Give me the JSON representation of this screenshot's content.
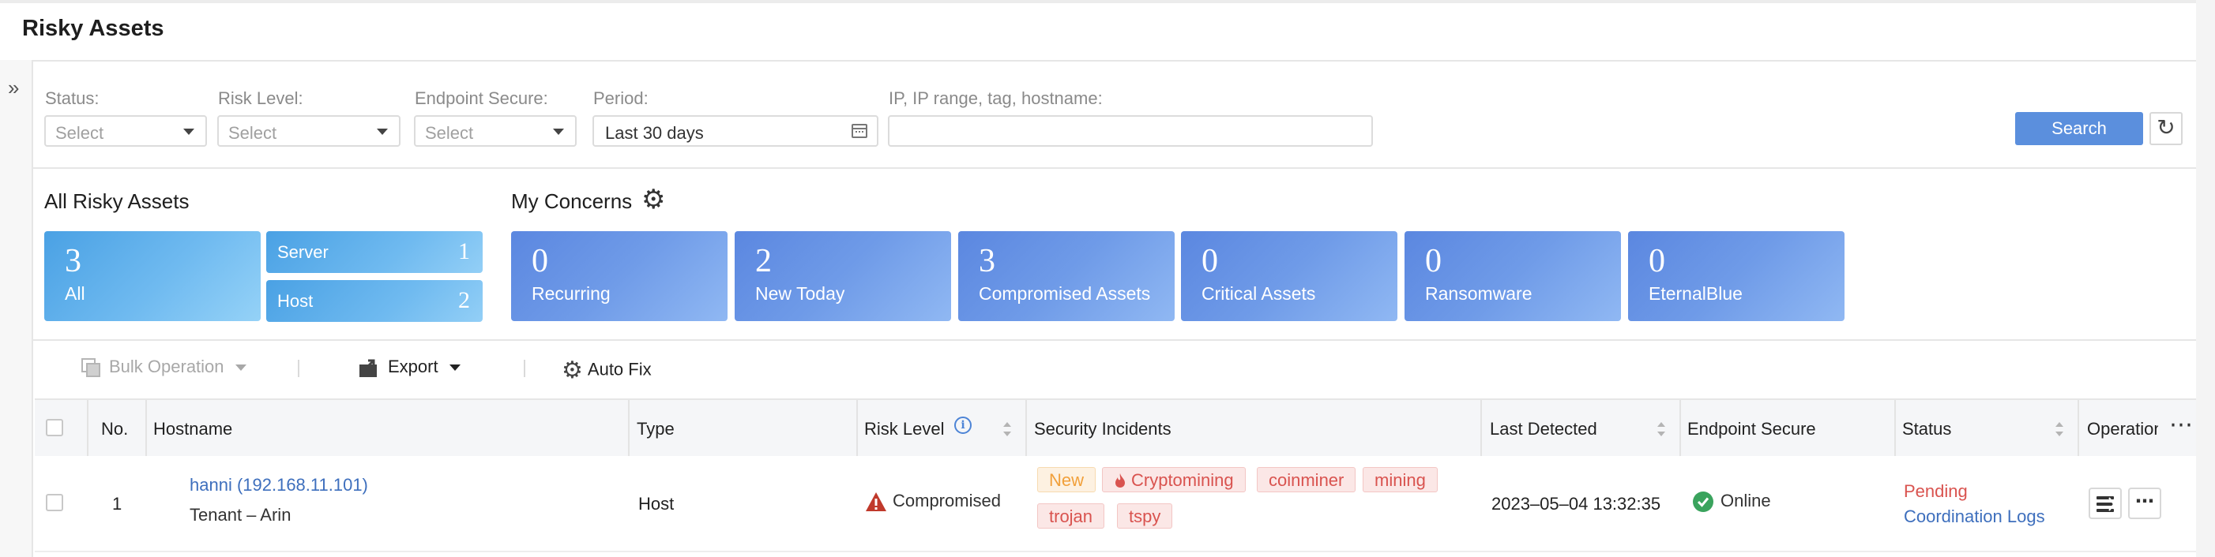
{
  "page": {
    "title": "Risky Assets"
  },
  "filters": {
    "status": {
      "label": "Status:",
      "placeholder": "Select"
    },
    "risk_level": {
      "label": "Risk Level:",
      "placeholder": "Select"
    },
    "endpoint_secure": {
      "label": "Endpoint Secure:",
      "placeholder": "Select"
    },
    "period": {
      "label": "Period:",
      "value": "Last 30 days"
    },
    "search_box": {
      "label": "IP, IP range, tag, hostname:",
      "value": ""
    },
    "search_button": "Search"
  },
  "all_risky_assets": {
    "title": "All Risky Assets",
    "all": {
      "count": "3",
      "label": "All"
    },
    "server": {
      "label": "Server",
      "count": "1"
    },
    "host": {
      "label": "Host",
      "count": "2"
    }
  },
  "my_concerns": {
    "title": "My Concerns",
    "cards": [
      {
        "count": "0",
        "label": "Recurring"
      },
      {
        "count": "2",
        "label": "New Today"
      },
      {
        "count": "3",
        "label": "Compromised Assets"
      },
      {
        "count": "0",
        "label": "Critical Assets"
      },
      {
        "count": "0",
        "label": "Ransomware"
      },
      {
        "count": "0",
        "label": "EternalBlue"
      }
    ]
  },
  "toolbar": {
    "bulk_operation": "Bulk Operation",
    "export": "Export",
    "auto_fix": "Auto Fix"
  },
  "table": {
    "columns": {
      "no": "No.",
      "hostname": "Hostname",
      "type": "Type",
      "risk_level": "Risk Level",
      "security_incidents": "Security Incidents",
      "last_detected": "Last Detected",
      "endpoint_secure": "Endpoint Secure",
      "status": "Status",
      "operation": "Operation"
    },
    "rows": [
      {
        "no": "1",
        "hostname": "hanni (192.168.11.101)",
        "tenant": "Tenant – Arin",
        "type": "Host",
        "risk_level": "Compromised",
        "incidents": [
          "New",
          "Cryptomining",
          "coinminer",
          "mining",
          "trojan",
          "tspy"
        ],
        "last_detected": "2023–05–04 13:32:35",
        "endpoint_secure": "Online",
        "status": "Pending",
        "status_link": "Coordination Logs"
      }
    ]
  },
  "colors": {
    "primary": "#5b8fdd",
    "link": "#3e6fbd",
    "danger": "#d9534f",
    "warning": "#f1a03a",
    "success": "#3aa35d"
  },
  "icons": [
    "expand-icon",
    "dropdown-caret-icon",
    "calendar-icon",
    "refresh-icon",
    "gear-icon",
    "bulk-operation-icon",
    "export-icon",
    "info-icon",
    "sort-icon",
    "warning-icon",
    "fire-icon",
    "check-circle-icon",
    "stack-icon",
    "more-icon"
  ]
}
